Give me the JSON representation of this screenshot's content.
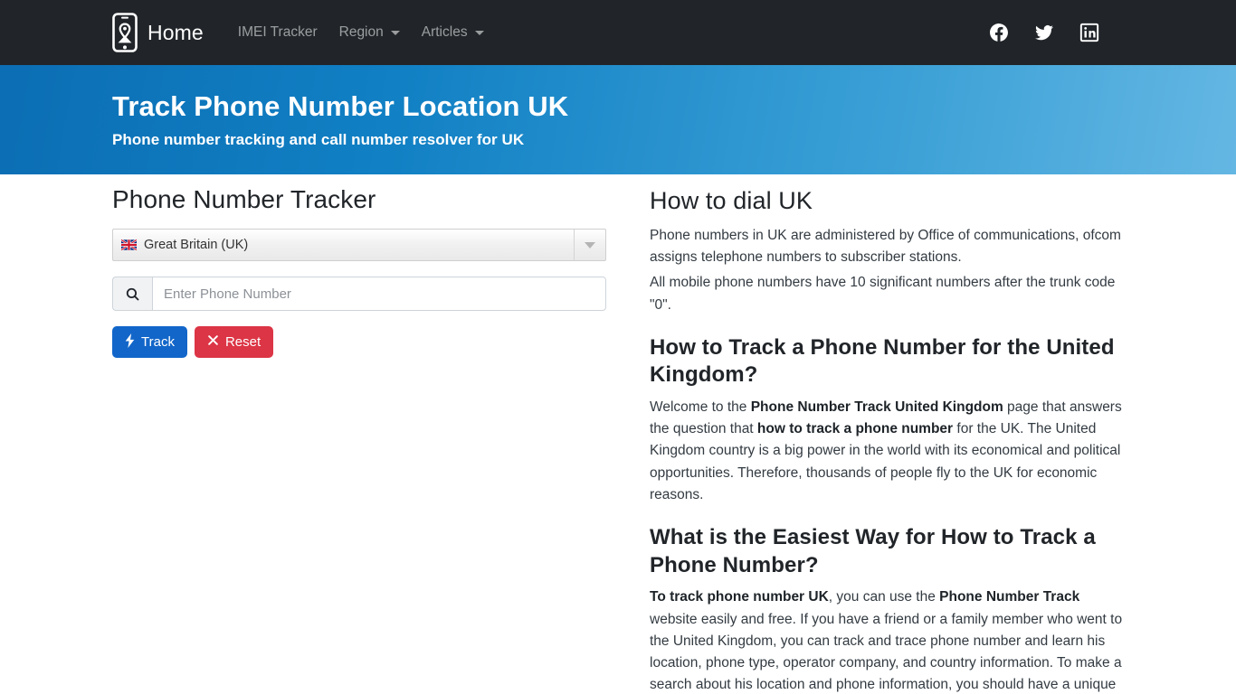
{
  "navbar": {
    "logo_icon": "phone-location-pin-icon",
    "brand": "Home",
    "links": [
      {
        "label": "IMEI Tracker",
        "has_caret": false
      },
      {
        "label": "Region",
        "has_caret": true
      },
      {
        "label": "Articles",
        "has_caret": true
      }
    ],
    "social": [
      {
        "name": "facebook-icon",
        "label": "Facebook"
      },
      {
        "name": "twitter-icon",
        "label": "Twitter"
      },
      {
        "name": "linkedin-icon",
        "label": "LinkedIn"
      }
    ],
    "background": "#212529"
  },
  "hero": {
    "title": "Track Phone Number Location UK",
    "subtitle": "Phone number tracking and call number resolver for UK",
    "gradient_from": "#0c6eb4",
    "gradient_to": "#64b7e3"
  },
  "form": {
    "title": "Phone Number Tracker",
    "country_select": {
      "value": "Great Britain (UK)",
      "flag_icon": "uk-flag-icon",
      "arrow_icon": "chevron-down-icon"
    },
    "phone_input": {
      "value": "",
      "placeholder": "Enter Phone Number",
      "prefix_icon": "search-icon"
    },
    "buttons": [
      {
        "label": "Track",
        "icon": "bolt-icon",
        "color": "#1266c9"
      },
      {
        "label": "Reset",
        "icon": "close-x-icon",
        "color": "#dc3545"
      }
    ]
  },
  "content": {
    "section1": {
      "heading": "How to dial UK",
      "paragraph1": "Phone numbers in UK are administered by Office of communications, ofcom assigns telephone numbers to subscriber stations.",
      "paragraph2": "All mobile phone numbers have 10 significant numbers after the trunk code \"0\"."
    },
    "section2": {
      "heading": "How to Track a Phone Number for the United Kingdom?",
      "p_part1": "Welcome to the ",
      "p_bold1": "Phone Number Track United Kingdom",
      "p_part2": " page that answers the question that ",
      "p_bold2": "how to track a phone number",
      "p_part3": " for the UK. The United Kingdom country is a big power in the world with its economical and political opportunities. Therefore, thousands of people fly to the UK for economic reasons."
    },
    "section3": {
      "heading": "What is the Easiest Way for How to Track a Phone Number?",
      "p_bold1": "To track phone number UK",
      "p_part1": ", you can use the ",
      "p_bold2": "Phone Number Track",
      "p_part2": " website easily and free. If you have a friend or a family member who went to the United Kingdom, you can track and trace phone number and learn his location, phone type, operator company, and country information. To make a search about his location and phone information, you should have a unique"
    }
  }
}
